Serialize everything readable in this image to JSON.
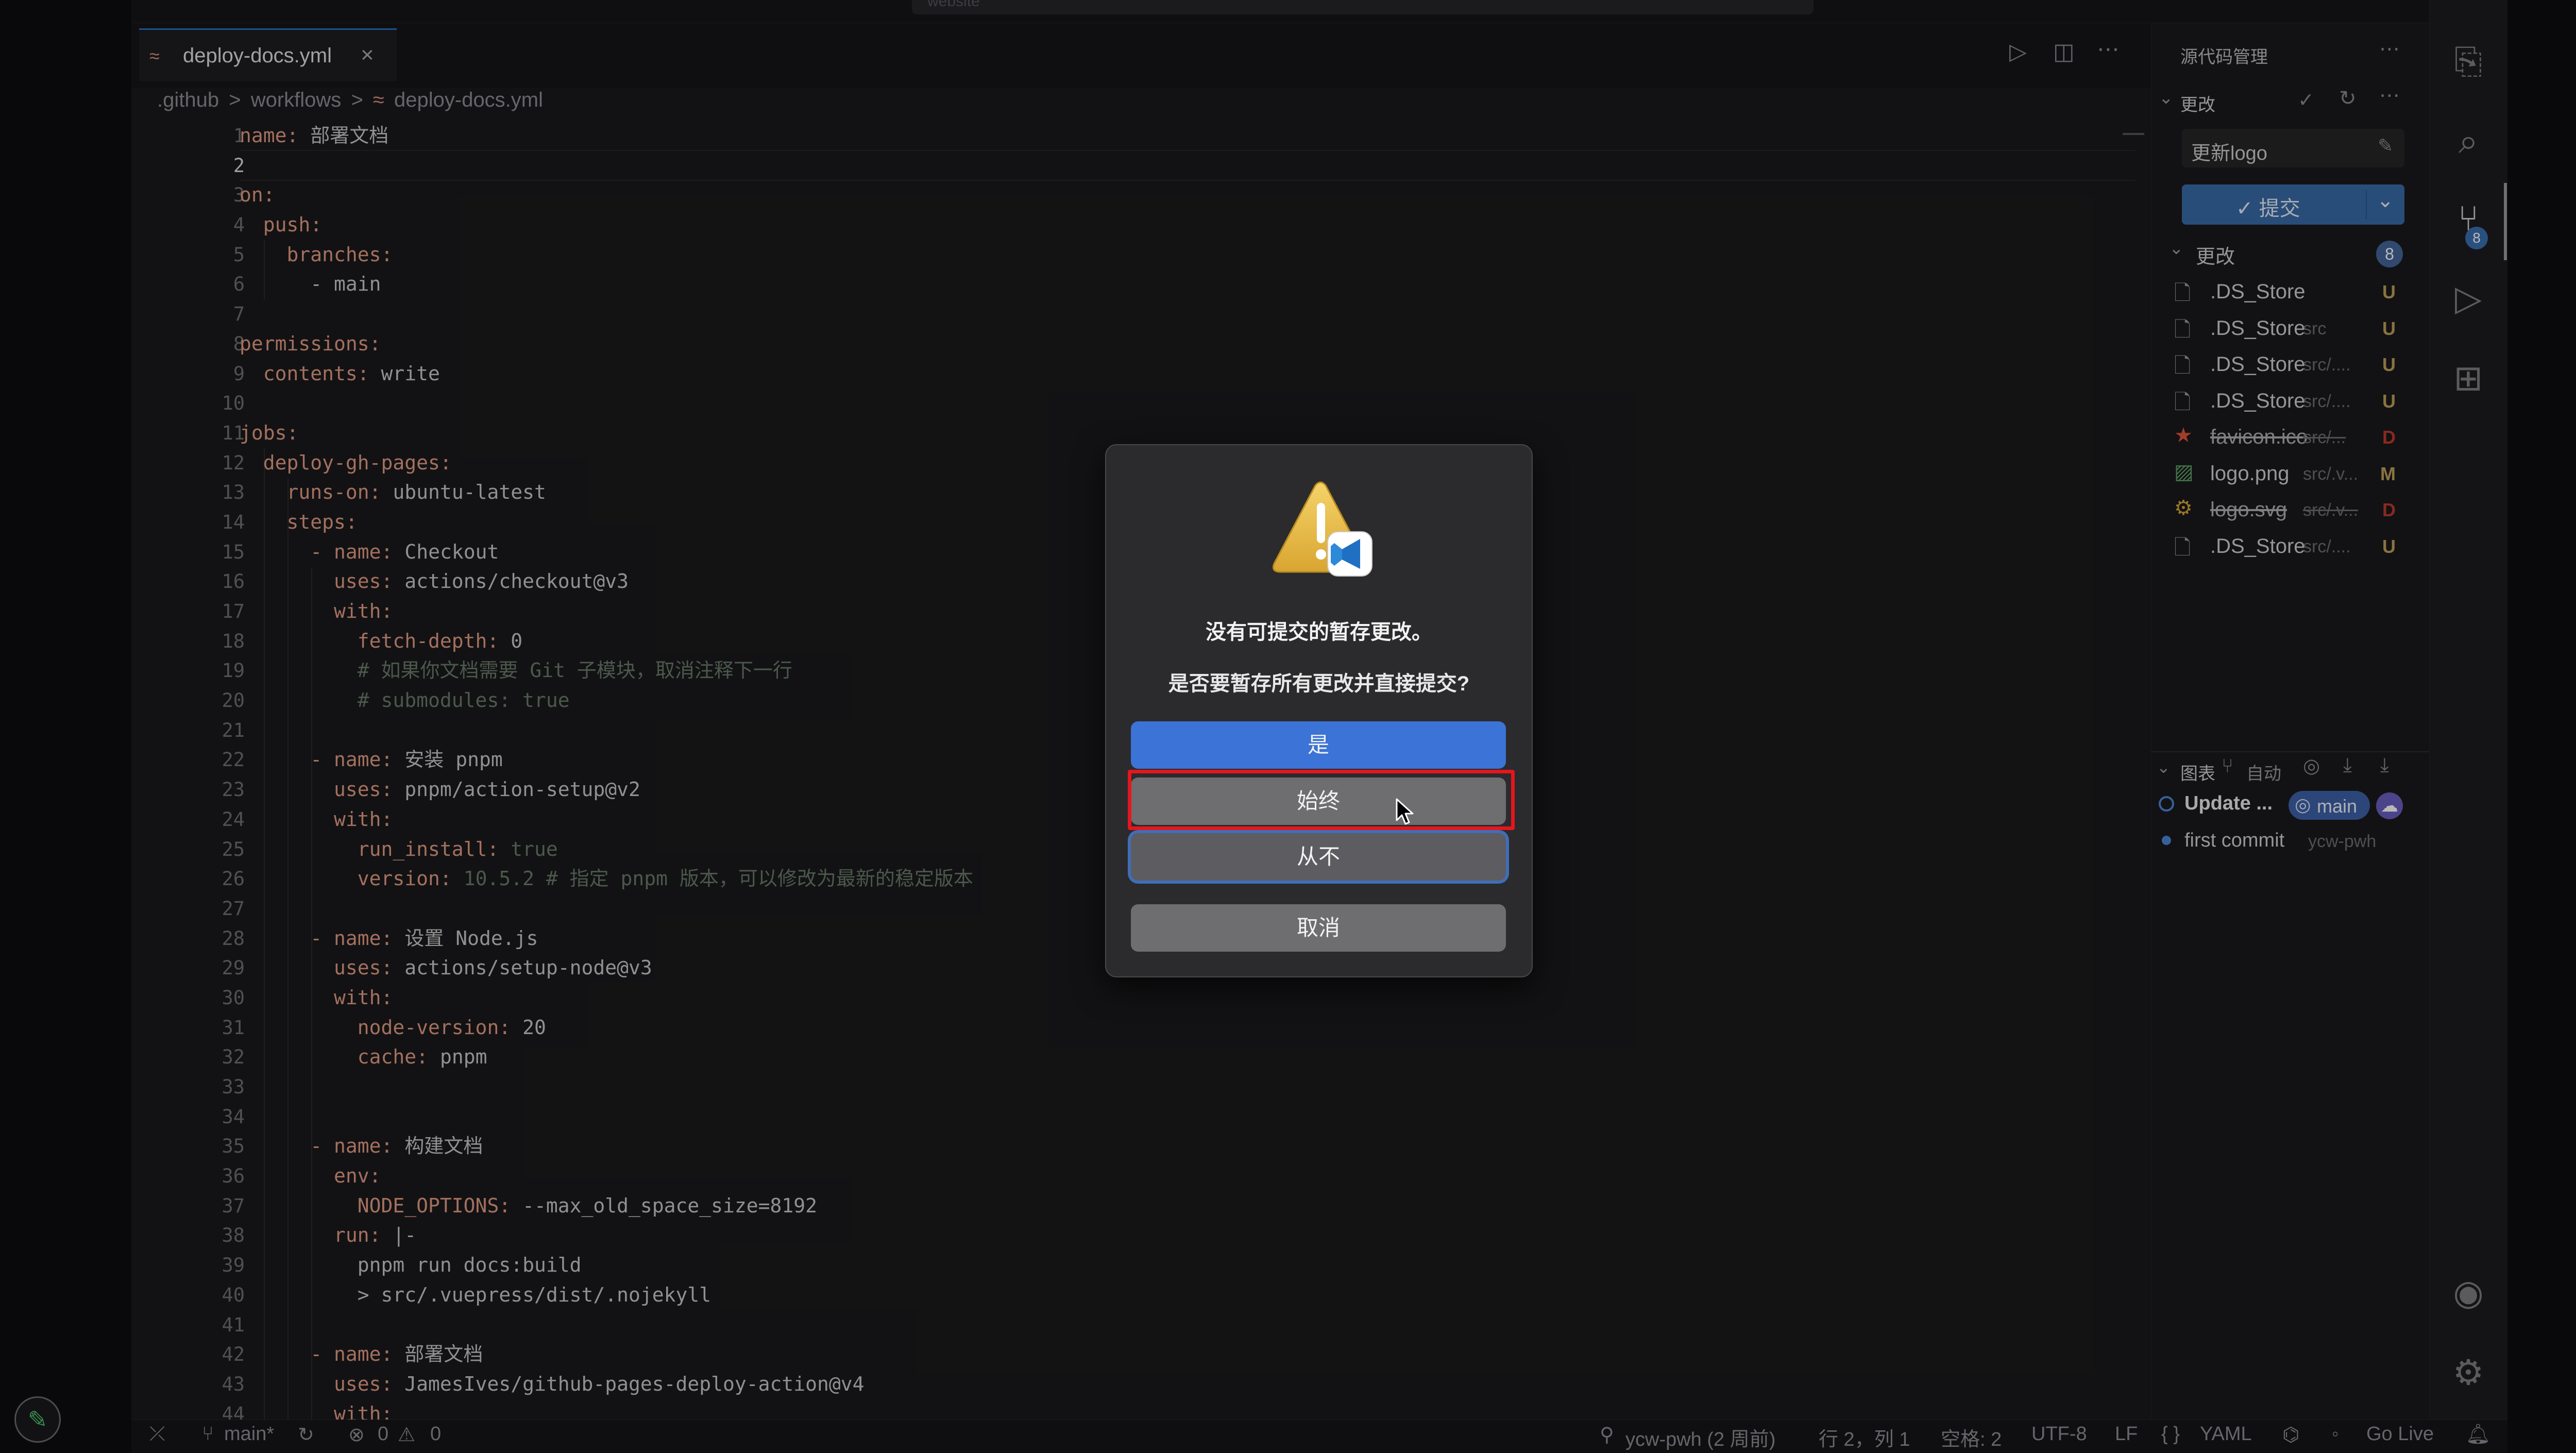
{
  "app": {
    "top_search": "website"
  },
  "editor": {
    "tab": {
      "label": "deploy-docs.yml",
      "close": "×"
    },
    "breadcrumb": [
      ".github",
      ">",
      "workflows",
      ">",
      "deploy-docs.yml"
    ],
    "current_line": 2,
    "lines": [
      {
        "n": "1",
        "indent": 0,
        "key": "name:",
        "val": " 部署文档",
        "cls": "v"
      },
      {
        "n": "2",
        "indent": 0,
        "key": "",
        "val": "",
        "cls": "v"
      },
      {
        "n": "3",
        "indent": 0,
        "key": "on:",
        "val": "",
        "cls": "v"
      },
      {
        "n": "4",
        "indent": 1,
        "key": "push:",
        "val": "",
        "cls": "v"
      },
      {
        "n": "5",
        "indent": 2,
        "key": "branches:",
        "val": "",
        "cls": "v"
      },
      {
        "n": "6",
        "indent": 3,
        "key": "",
        "val": "- main",
        "cls": "v"
      },
      {
        "n": "7",
        "indent": 0,
        "key": "",
        "val": "",
        "cls": "v"
      },
      {
        "n": "8",
        "indent": 0,
        "key": "permissions:",
        "val": "",
        "cls": "v"
      },
      {
        "n": "9",
        "indent": 1,
        "key": "contents:",
        "val": " write",
        "cls": "v"
      },
      {
        "n": "10",
        "indent": 0,
        "key": "",
        "val": "",
        "cls": "v"
      },
      {
        "n": "11",
        "indent": 0,
        "key": "jobs:",
        "val": "",
        "cls": "v"
      },
      {
        "n": "12",
        "indent": 1,
        "key": "deploy-gh-pages:",
        "val": "",
        "cls": "v"
      },
      {
        "n": "13",
        "indent": 2,
        "key": "runs-on:",
        "val": " ubuntu-latest",
        "cls": "v"
      },
      {
        "n": "14",
        "indent": 2,
        "key": "steps:",
        "val": "",
        "cls": "v"
      },
      {
        "n": "15",
        "indent": 3,
        "key": "- name:",
        "val": " Checkout",
        "cls": "v"
      },
      {
        "n": "16",
        "indent": 4,
        "key": "uses:",
        "val": " actions/checkout@v3",
        "cls": "v"
      },
      {
        "n": "17",
        "indent": 4,
        "key": "with:",
        "val": "",
        "cls": "v"
      },
      {
        "n": "18",
        "indent": 5,
        "key": "fetch-depth:",
        "val": " 0",
        "cls": "v"
      },
      {
        "n": "19",
        "indent": 5,
        "key": "",
        "val": "# 如果你文档需要 Git 子模块，取消注释下一行",
        "cls": "c"
      },
      {
        "n": "20",
        "indent": 5,
        "key": "",
        "val": "# submodules: true",
        "cls": "c"
      },
      {
        "n": "21",
        "indent": 0,
        "key": "",
        "val": "",
        "cls": "v"
      },
      {
        "n": "22",
        "indent": 3,
        "key": "- name:",
        "val": " 安装 pnpm",
        "cls": "v"
      },
      {
        "n": "23",
        "indent": 4,
        "key": "uses:",
        "val": " pnpm/action-setup@v2",
        "cls": "v"
      },
      {
        "n": "24",
        "indent": 4,
        "key": "with:",
        "val": "",
        "cls": "v"
      },
      {
        "n": "25",
        "indent": 5,
        "key": "run_install:",
        "val": " true",
        "cls": "c"
      },
      {
        "n": "26",
        "indent": 5,
        "key": "version:",
        "val": " 10.5.2 # 指定 pnpm 版本，可以修改为最新的稳定版本",
        "cls": "c"
      },
      {
        "n": "27",
        "indent": 0,
        "key": "",
        "val": "",
        "cls": "v"
      },
      {
        "n": "28",
        "indent": 3,
        "key": "- name:",
        "val": " 设置 Node.js",
        "cls": "v"
      },
      {
        "n": "29",
        "indent": 4,
        "key": "uses:",
        "val": " actions/setup-node@v3",
        "cls": "v"
      },
      {
        "n": "30",
        "indent": 4,
        "key": "with:",
        "val": "",
        "cls": "v"
      },
      {
        "n": "31",
        "indent": 5,
        "key": "node-version:",
        "val": " 20",
        "cls": "v"
      },
      {
        "n": "32",
        "indent": 5,
        "key": "cache:",
        "val": " pnpm",
        "cls": "v"
      },
      {
        "n": "33",
        "indent": 0,
        "key": "",
        "val": "",
        "cls": "v"
      },
      {
        "n": "34",
        "indent": 0,
        "key": "",
        "val": "",
        "cls": "v"
      },
      {
        "n": "35",
        "indent": 3,
        "key": "- name:",
        "val": " 构建文档",
        "cls": "v"
      },
      {
        "n": "36",
        "indent": 4,
        "key": "env:",
        "val": "",
        "cls": "v"
      },
      {
        "n": "37",
        "indent": 5,
        "key": "NODE_OPTIONS:",
        "val": " --max_old_space_size=8192",
        "cls": "v"
      },
      {
        "n": "38",
        "indent": 4,
        "key": "run:",
        "val": " |-",
        "cls": "v"
      },
      {
        "n": "39",
        "indent": 5,
        "key": "",
        "val": "pnpm run docs:build",
        "cls": "v"
      },
      {
        "n": "40",
        "indent": 5,
        "key": "",
        "val": "> src/.vuepress/dist/.nojekyll",
        "cls": "v"
      },
      {
        "n": "41",
        "indent": 0,
        "key": "",
        "val": "",
        "cls": "v"
      },
      {
        "n": "42",
        "indent": 3,
        "key": "- name:",
        "val": " 部署文档",
        "cls": "v"
      },
      {
        "n": "43",
        "indent": 4,
        "key": "uses:",
        "val": " JamesIves/github-pages-deploy-action@v4",
        "cls": "v"
      },
      {
        "n": "44",
        "indent": 4,
        "key": "with:",
        "val": "",
        "cls": "v"
      }
    ]
  },
  "scm": {
    "header": "源代码管理",
    "section_label": "更改",
    "commit_message": "更新logo",
    "commit_button": "✓ 提交",
    "changes_label": "更改",
    "changes_count": "8",
    "files": [
      {
        "name": ".DS_Store",
        "path": "",
        "status": "U",
        "icon": "file-icon",
        "deleted": false
      },
      {
        "name": ".DS_Store",
        "path": "src",
        "status": "U",
        "icon": "file-icon",
        "deleted": false
      },
      {
        "name": ".DS_Store",
        "path": "src/....",
        "status": "U",
        "icon": "file-icon",
        "deleted": false
      },
      {
        "name": ".DS_Store",
        "path": "src/....",
        "status": "U",
        "icon": "file-icon",
        "deleted": false
      },
      {
        "name": "favicon.ico",
        "path": "src/...",
        "status": "D",
        "icon": "star-image-icon",
        "deleted": true
      },
      {
        "name": "logo.png",
        "path": "src/.v...",
        "status": "M",
        "icon": "image-icon",
        "deleted": false
      },
      {
        "name": "logo.svg",
        "path": "src/.v...",
        "status": "D",
        "icon": "svg-icon",
        "deleted": true
      },
      {
        "name": ".DS_Store",
        "path": "src/....",
        "status": "U",
        "icon": "file-icon",
        "deleted": false
      }
    ],
    "graph": {
      "label": "图表",
      "auto": "自动",
      "commits": [
        {
          "message": "Update ...",
          "badge": "main",
          "author": ""
        },
        {
          "message": "first commit",
          "badge": "",
          "author": "ycw-pwh"
        }
      ]
    }
  },
  "dialog": {
    "title": "没有可提交的暂存更改。",
    "message": "是否要暂存所有更改并直接提交?",
    "buttons": {
      "yes": "是",
      "always": "始终",
      "never": "从不",
      "cancel": "取消"
    }
  },
  "statusbar": {
    "branch": "main*",
    "errors": "0",
    "warnings": "0",
    "blame": "ycw-pwh (2 周前)",
    "position": "行 2，列 1",
    "spaces": "空格: 2",
    "encoding": "UTF-8",
    "eol": "LF",
    "language": "YAML",
    "golive": "Go Live"
  },
  "colors": {
    "accent": "#3c73d6",
    "highlight_box": "#e5161c",
    "status_untracked": "#c0a05a",
    "status_deleted": "#c0392b",
    "status_modified": "#c0a05a"
  }
}
